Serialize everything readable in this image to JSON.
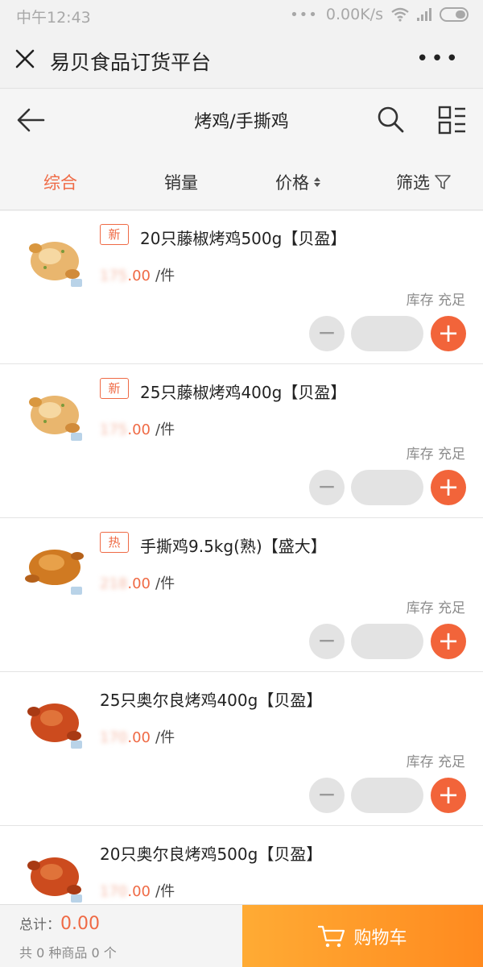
{
  "status": {
    "time": "中午12:43",
    "net": "0.00K/s",
    "dots": "•••"
  },
  "appbar": {
    "title": "易贝食品订货平台",
    "more": "•••"
  },
  "nav": {
    "category": "烤鸡/手撕鸡"
  },
  "sort": {
    "all": "综合",
    "sales": "销量",
    "price": "价格",
    "filter": "筛选"
  },
  "products": [
    {
      "tag": "新",
      "name": "20只藤椒烤鸡500g【贝盈】",
      "price_whole": "175",
      "price_cents": ".00",
      "unit": "/件",
      "stock": "库存 充足",
      "thumb": "roast"
    },
    {
      "tag": "新",
      "name": "25只藤椒烤鸡400g【贝盈】",
      "price_whole": "175",
      "price_cents": ".00",
      "unit": "/件",
      "stock": "库存 充足",
      "thumb": "roast"
    },
    {
      "tag": "热",
      "name": "手撕鸡9.5kg(熟)【盛大】",
      "price_whole": "218",
      "price_cents": ".00",
      "unit": "/件",
      "stock": "库存 充足",
      "thumb": "shredded"
    },
    {
      "tag": "",
      "name": "25只奥尔良烤鸡400g【贝盈】",
      "price_whole": "170",
      "price_cents": ".00",
      "unit": "/件",
      "stock": "库存 充足",
      "thumb": "orleans"
    },
    {
      "tag": "",
      "name": "20只奥尔良烤鸡500g【贝盈】",
      "price_whole": "170",
      "price_cents": ".00",
      "unit": "/件",
      "stock": "",
      "thumb": "orleans"
    }
  ],
  "bottom": {
    "total_label": "总计：",
    "total_amount": "0.00",
    "count_text": "共 0 种商品 0 个",
    "cart_label": "购物车"
  },
  "colors": {
    "accent": "#ef6a45",
    "plus": "#f2643a",
    "cart_start": "#ffab34",
    "cart_end": "#ff8a1f"
  }
}
